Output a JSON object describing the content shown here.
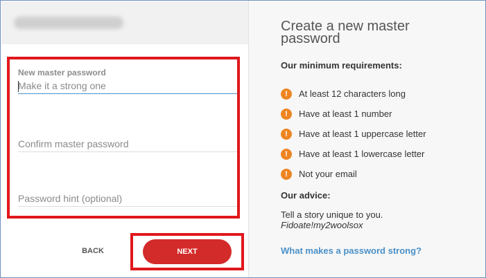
{
  "form": {
    "new_password": {
      "label": "New master password",
      "placeholder": "Make it a strong one",
      "value": ""
    },
    "confirm_password": {
      "placeholder": "Confirm master password",
      "value": ""
    },
    "password_hint": {
      "placeholder": "Password hint (optional)",
      "value": ""
    }
  },
  "actions": {
    "back_label": "BACK",
    "next_label": "NEXT"
  },
  "info": {
    "title": "Create a new master password",
    "requirements_heading": "Our minimum requirements:",
    "requirements": [
      "At least 12 characters long",
      "Have at least 1 number",
      "Have at least 1 uppercase letter",
      "Have at least 1 lowercase letter",
      "Not your email"
    ],
    "requirement_icon": "!",
    "advice_heading": "Our advice:",
    "advice_text": "Tell a story unique to you.",
    "advice_example": "Fidoate!my2woolsox",
    "link_label": "What makes a password strong?"
  },
  "colors": {
    "highlight": "#e0181c",
    "next_button": "#d32b2a",
    "warning_icon": "#ee8522",
    "link": "#4a90c8"
  }
}
